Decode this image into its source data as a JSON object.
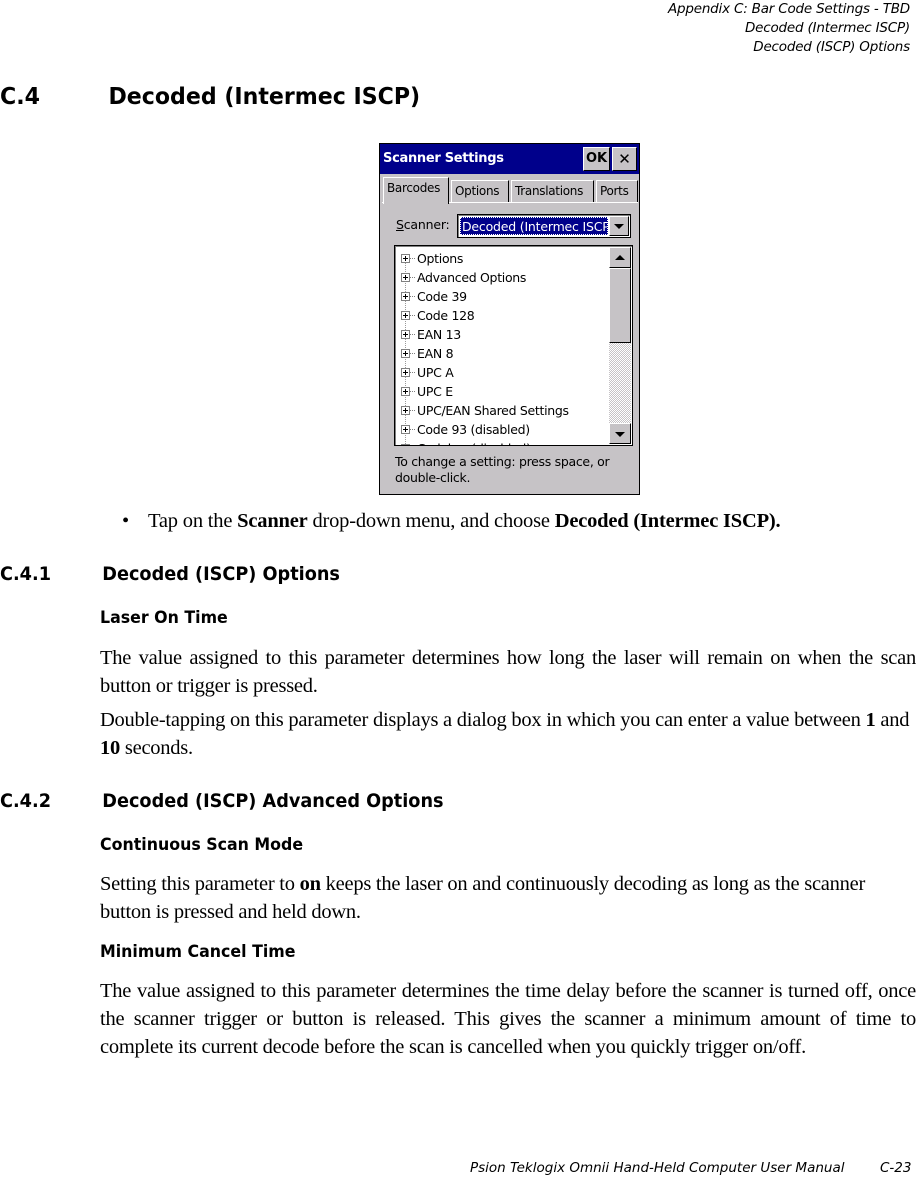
{
  "running_head": {
    "line1": "Appendix C: Bar Code Settings - TBD",
    "line2": "Decoded (Intermec ISCP)",
    "line3": "Decoded (ISCP) Options"
  },
  "section": {
    "number": "C.4",
    "title": "Decoded (Intermec ISCP)"
  },
  "dialog": {
    "title": "Scanner Settings",
    "ok_label": "OK",
    "close_glyph": "✕",
    "tabs": [
      {
        "label": "Barcodes",
        "active": true
      },
      {
        "label": "Options",
        "active": false
      },
      {
        "label": "Translations",
        "active": false
      },
      {
        "label": "Ports",
        "active": false
      }
    ],
    "scanner_label_prefix": "S",
    "scanner_label_rest": "canner:",
    "scanner_value": "Decoded (Intermec ISCP)",
    "tree_items": [
      "Options",
      "Advanced Options",
      "Code 39",
      "Code 128",
      "EAN 13",
      "EAN 8",
      "UPC A",
      "UPC E",
      "UPC/EAN Shared Settings",
      "Code 93 (disabled)",
      "Codabar (disabled)"
    ],
    "scroll_position_fraction": 0.0,
    "hint": "To change a setting: press space, or double-click."
  },
  "bullet": {
    "glyph": "•",
    "text1": "Tap on the ",
    "bold1": "Scanner",
    "text2": " drop-down menu, and choose ",
    "bold2": "Decoded (Intermec ISCP)."
  },
  "sub1": {
    "number": "C.4.1",
    "title": "Decoded (ISCP) Options",
    "h3": "Laser On Time",
    "para1": "The value assigned to this parameter determines how long the laser will remain on when the scan button or trigger is pressed.",
    "para2_a": "Double-tapping on this parameter displays a dialog box in which you can enter a value between ",
    "para2_b1": "1",
    "para2_c": " and ",
    "para2_b2": "10",
    "para2_d": " seconds."
  },
  "sub2": {
    "number": "C.4.2",
    "title": "Decoded (ISCP) Advanced Options",
    "h3a": "Continuous Scan Mode",
    "para_a1": "Setting this parameter to ",
    "para_ab": "on",
    "para_a2": " keeps the laser on and continuously decoding as long as the scanner button is pressed and held down.",
    "h3b": "Minimum Cancel Time",
    "para_b": "The value assigned to this parameter determines the time delay before the scanner is turned off, once the scanner trigger or button is released. This gives the scanner a minimum amount of time to complete its current decode before the scan is cancelled when you quickly trigger on/off."
  },
  "footer": {
    "manual": "Psion Teklogix Omnii Hand-Held Computer User Manual",
    "page": "C-23"
  }
}
